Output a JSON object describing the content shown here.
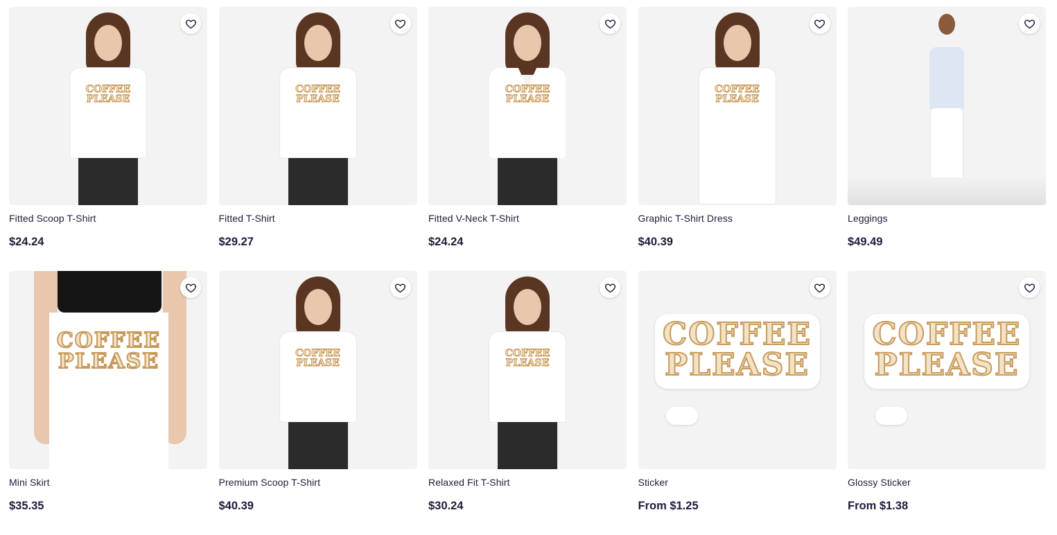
{
  "products": [
    {
      "title": "Fitted Scoop T-Shirt",
      "price": "$24.24",
      "kind": "tee",
      "print": "COFFEE\nPLEASE"
    },
    {
      "title": "Fitted T-Shirt",
      "price": "$29.27",
      "kind": "tee",
      "print": "COFFEE\nPLEASE"
    },
    {
      "title": "Fitted V-Neck T-Shirt",
      "price": "$24.24",
      "kind": "vneck",
      "print": "COFFEE\nPLEASE"
    },
    {
      "title": "Graphic T-Shirt Dress",
      "price": "$40.39",
      "kind": "dress",
      "print": "COFFEE\nPLEASE"
    },
    {
      "title": "Leggings",
      "price": "$49.49",
      "kind": "leggings",
      "print": ""
    },
    {
      "title": "Mini Skirt",
      "price": "$35.35",
      "kind": "skirt",
      "print": "COFFEE\nPLEASE"
    },
    {
      "title": "Premium Scoop T-Shirt",
      "price": "$40.39",
      "kind": "tee",
      "print": "COFFEE\nPLEASE"
    },
    {
      "title": "Relaxed Fit T-Shirt",
      "price": "$30.24",
      "kind": "tee",
      "print": "COFFEE\nPLEASE"
    },
    {
      "title": "Sticker",
      "price": "From $1.25",
      "kind": "sticker",
      "print": "COFFEE\nPLEASE"
    },
    {
      "title": "Glossy Sticker",
      "price": "From $1.38",
      "kind": "sticker",
      "print": "COFFEE\nPLEASE"
    }
  ],
  "icons": {
    "favorite": "heart-outline-icon"
  },
  "colors": {
    "text": "#1d1b3a",
    "thumb_bg": "#f3f3f3",
    "print_fill": "#f3e3c6",
    "print_stroke": "#c89a5a"
  }
}
